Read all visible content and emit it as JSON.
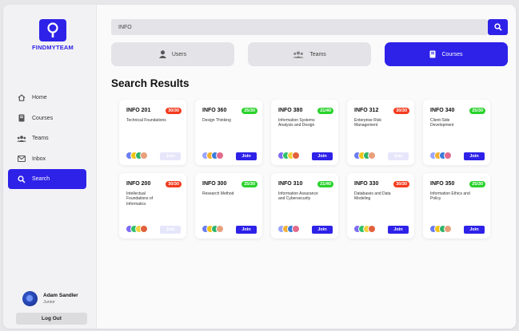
{
  "brand": {
    "name": "FINDMYTEAM",
    "color": "#2e22e8"
  },
  "sidebar": {
    "items": [
      {
        "label": "Home",
        "icon": "home-icon"
      },
      {
        "label": "Courses",
        "icon": "book-icon"
      },
      {
        "label": "Teams",
        "icon": "group-icon"
      },
      {
        "label": "Inbox",
        "icon": "mail-icon"
      },
      {
        "label": "Search",
        "icon": "search-icon",
        "active": true
      }
    ],
    "user": {
      "name": "Adam Sandler",
      "role": "Junior"
    },
    "logout_label": "Log Out"
  },
  "search": {
    "value": "INFO"
  },
  "tabs": [
    {
      "label": "Users",
      "icon": "user-icon"
    },
    {
      "label": "Teams",
      "icon": "group-icon"
    },
    {
      "label": "Courses",
      "icon": "book-icon",
      "active": true
    }
  ],
  "results_title": "Search Results",
  "join_label": "Join",
  "colors": {
    "full": "#f33b1e",
    "open": "#29d22c",
    "accent": "#2e22e8"
  },
  "courses": [
    {
      "code": "INFO 201",
      "capacity": "30/30",
      "status": "full",
      "desc": "Technical Foundations",
      "joinable": false
    },
    {
      "code": "INFO 360",
      "capacity": "25/30",
      "status": "open",
      "desc": "Design Thinking",
      "joinable": true
    },
    {
      "code": "INFO 380",
      "capacity": "21/40",
      "status": "open",
      "desc": "Information Systems Analysis and Design",
      "joinable": true
    },
    {
      "code": "INFO 312",
      "capacity": "30/30",
      "status": "full",
      "desc": "Enterprise Risk Management",
      "joinable": false
    },
    {
      "code": "INFO 340",
      "capacity": "25/30",
      "status": "open",
      "desc": "Client-Side Development",
      "joinable": true
    },
    {
      "code": "INFO 200",
      "capacity": "30/30",
      "status": "full",
      "desc": "Intellectual Foundations of Informatics",
      "joinable": false
    },
    {
      "code": "INFO 300",
      "capacity": "25/30",
      "status": "open",
      "desc": "Research Method",
      "joinable": true
    },
    {
      "code": "INFO 310",
      "capacity": "21/40",
      "status": "open",
      "desc": "Information Assurance and Cybersecurity",
      "joinable": true
    },
    {
      "code": "INFO 330",
      "capacity": "30/30",
      "status": "full",
      "desc": "Databases and Data Modeling",
      "joinable": true
    },
    {
      "code": "INFO 350",
      "capacity": "25/30",
      "status": "open",
      "desc": "Information Ethics and Policy",
      "joinable": true
    }
  ]
}
